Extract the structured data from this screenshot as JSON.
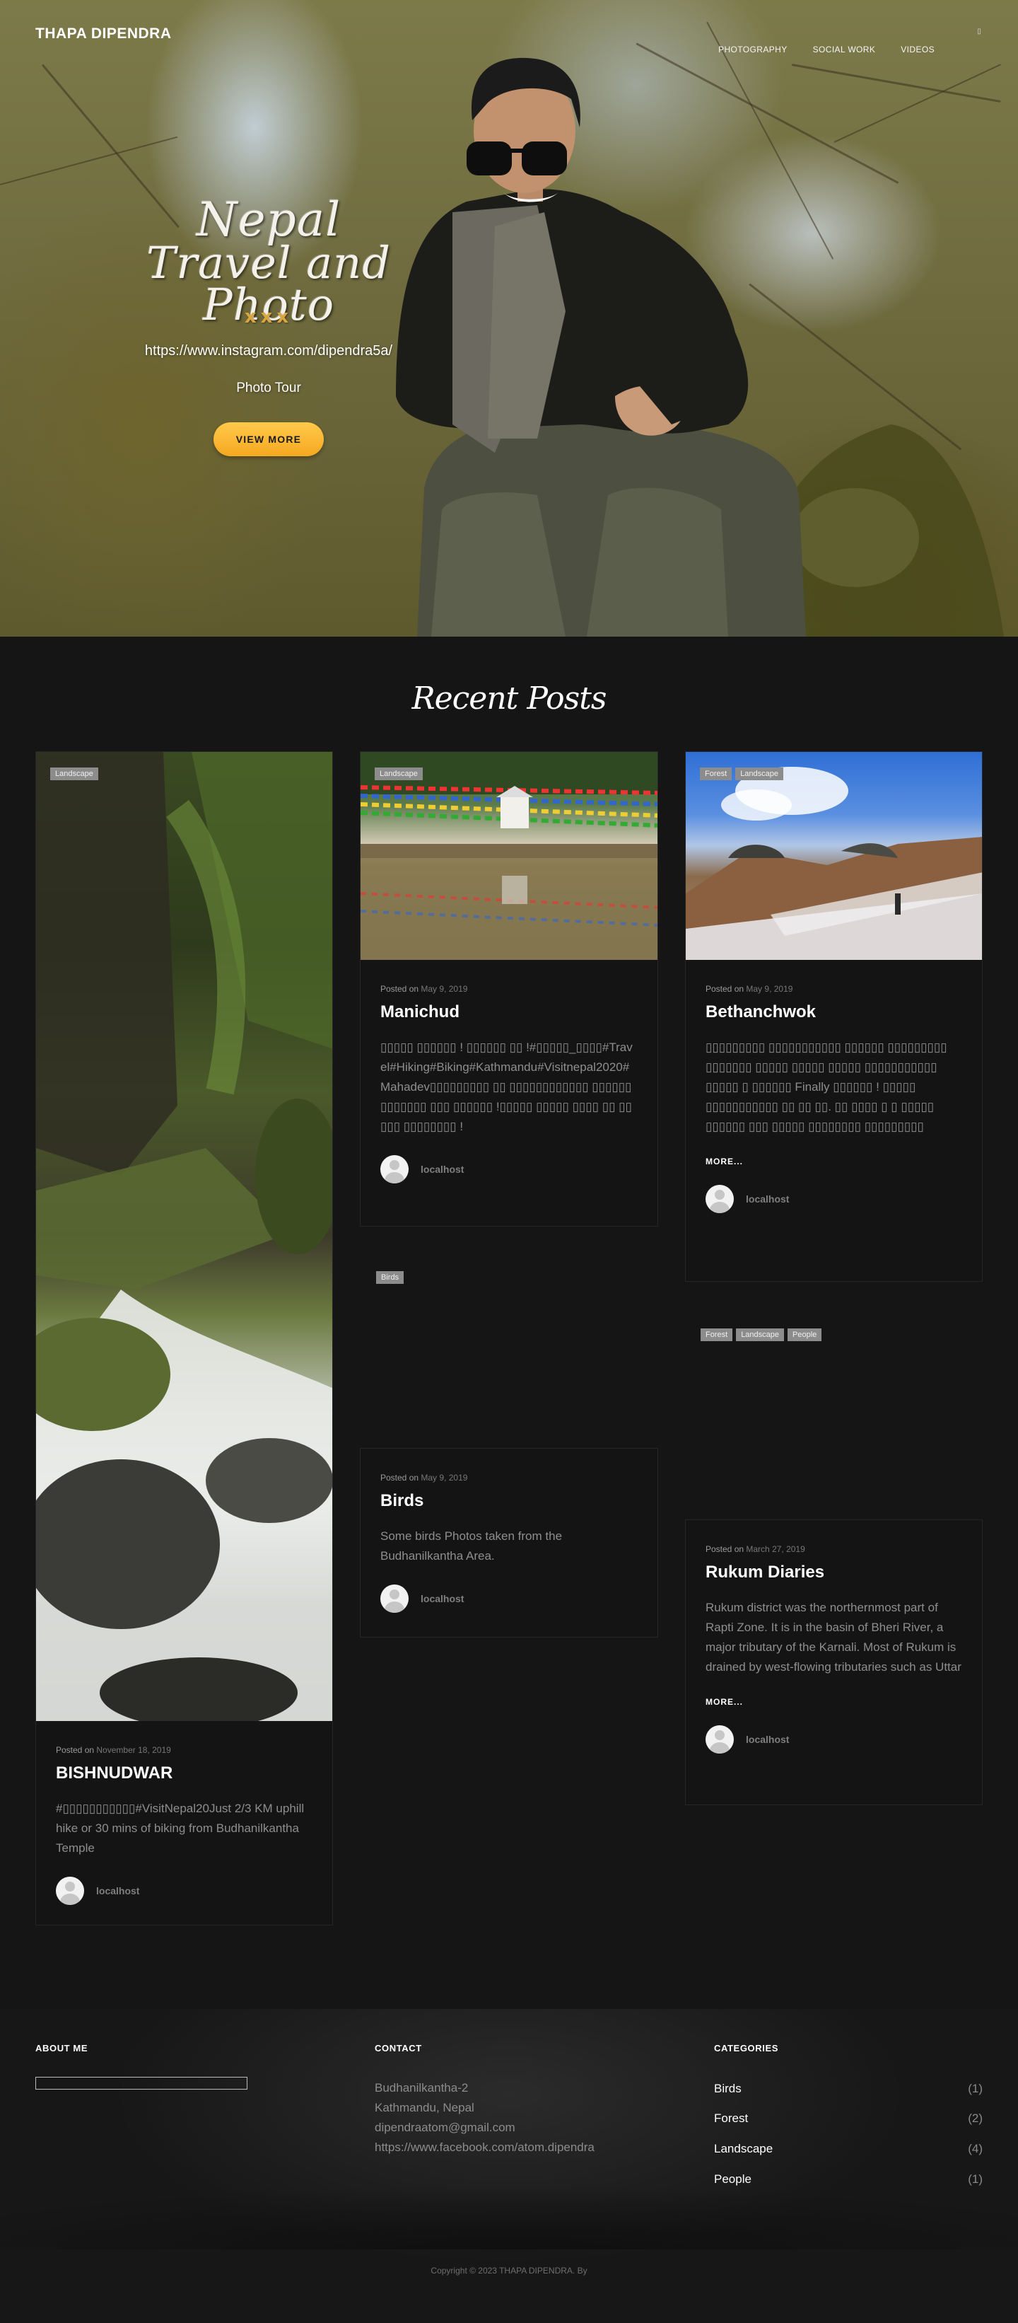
{
  "nav": {
    "brand": "THAPA DIPENDRA",
    "items": [
      "PHOTOGRAPHY",
      "SOCIAL WORK",
      "VIDEOS"
    ],
    "toggle_icon": "menu-icon"
  },
  "hero": {
    "title_line1": "Nepal",
    "title_line2": "Travel and Photo",
    "kisses": "xxx",
    "link": "https://www.instagram.com/dipendra5a/",
    "subtitle": "Photo Tour",
    "button": "VIEW MORE"
  },
  "recent": {
    "title": "Recent Posts"
  },
  "posts": [
    {
      "tags": [
        "Landscape"
      ],
      "posted_prefix": "Posted on",
      "date": "November 18, 2019",
      "title": "BISHNUDWAR",
      "excerpt": "#▯▯▯▯▯▯▯▯▯▯▯#VisitNepal20Just 2/3 KM uphill hike or 30 mins of biking from Budhanilkantha Temple",
      "more": "",
      "author": "localhost"
    },
    {
      "tags": [
        "Landscape"
      ],
      "posted_prefix": "Posted on",
      "date": "May 9, 2019",
      "title": "Manichud",
      "excerpt": "▯▯▯▯▯ ▯▯▯▯▯▯ ! ▯▯▯▯▯▯ ▯▯ !#▯▯▯▯▯_▯▯▯▯#Travel#Hiking#Biking#Kathmandu#Visitnepal2020#Mahadev▯▯▯▯▯▯▯▯▯ ▯▯ ▯▯▯▯▯▯▯▯▯▯▯▯ ▯▯▯▯▯▯ ▯▯▯▯▯▯▯ ▯▯▯ ▯▯▯▯▯▯ !▯▯▯▯▯ ▯▯▯▯▯ ▯▯▯▯ ▯▯ ▯▯▯▯▯ ▯▯▯▯▯▯▯▯ !",
      "more": "",
      "author": "localhost"
    },
    {
      "tags": [
        "Forest",
        "Landscape"
      ],
      "posted_prefix": "Posted on",
      "date": "May 9, 2019",
      "title": "Bethanchwok",
      "excerpt": "▯▯▯▯▯▯▯▯▯ ▯▯▯▯▯▯▯▯▯▯▯ ▯▯▯▯▯▯ ▯▯▯▯▯▯▯▯▯ ▯▯▯▯▯▯▯ ▯▯▯▯▯ ▯▯▯▯▯ ▯▯▯▯▯ ▯▯▯▯▯▯▯▯▯▯▯ ▯▯▯▯▯ ▯ ▯▯▯▯▯▯ Finally ▯▯▯▯▯▯ ! ▯▯▯▯▯ ▯▯▯▯▯▯▯▯▯▯▯ ▯▯ ▯▯ ▯▯. ▯▯ ▯▯▯▯ ▯ ▯ ▯▯▯▯▯ ▯▯▯▯▯▯ ▯▯▯ ▯▯▯▯▯ ▯▯▯▯▯▯▯▯ ▯▯▯▯▯▯▯▯▯",
      "more": "MORE...",
      "author": "localhost"
    },
    {
      "tags": [
        "Birds"
      ],
      "posted_prefix": "Posted on",
      "date": "May 9, 2019",
      "title": "Birds",
      "excerpt": "Some birds Photos taken from the Budhanilkantha Area.",
      "more": "",
      "author": "localhost"
    },
    {
      "tags": [
        "Forest",
        "Landscape",
        "People"
      ],
      "posted_prefix": "Posted on",
      "date": "March 27, 2019",
      "title": "Rukum Diaries",
      "excerpt": "Rukum district was the northernmost part of Rapti Zone. It is in the basin of Bheri River, a major tributary of the Karnali. Most of Rukum is drained by west-flowing tributaries such as Uttar",
      "more": "MORE...",
      "author": "localhost"
    }
  ],
  "footer": {
    "about_title": "ABOUT ME",
    "contact_title": "CONTACT",
    "contact_lines": [
      "Budhanilkantha-2",
      "Kathmandu, Nepal",
      "dipendraatom@gmail.com",
      "https://www.facebook.com/atom.dipendra"
    ],
    "categories_title": "CATEGORIES",
    "categories": [
      {
        "name": "Birds",
        "count": "(1)"
      },
      {
        "name": "Forest",
        "count": "(2)"
      },
      {
        "name": "Landscape",
        "count": "(4)"
      },
      {
        "name": "People",
        "count": "(1)"
      }
    ],
    "copyright": "Copyright © 2023 THAPA DIPENDRA. By"
  }
}
